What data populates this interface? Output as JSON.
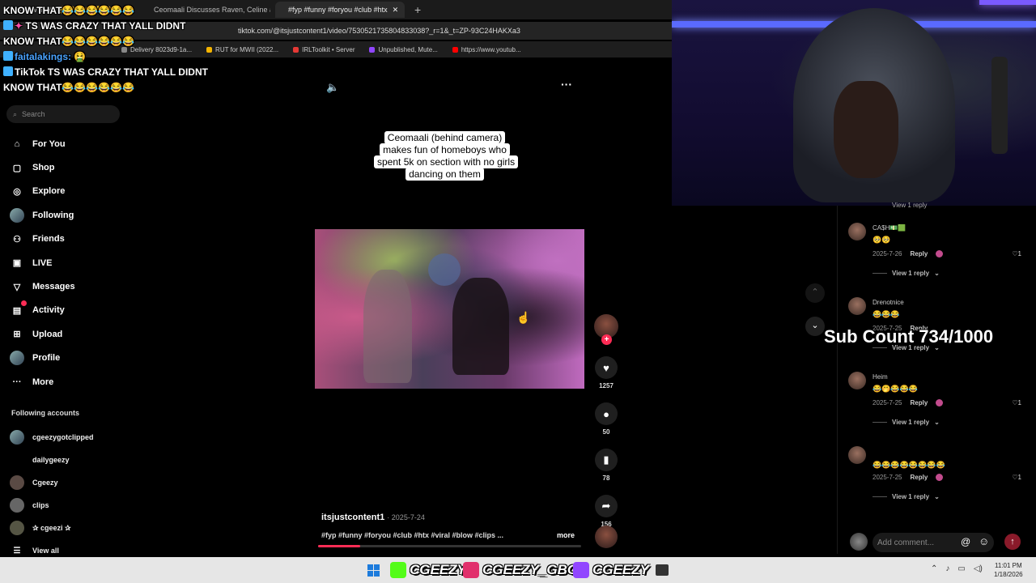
{
  "browser": {
    "tabs": [
      {
        "label": "KNOW THAT😂😂😂😂😂😂",
        "active": false
      },
      {
        "label": "Ceomaali Discusses Raven, Celine an",
        "active": false
      },
      {
        "label": "#fyp #funny #foryou #club #htx",
        "active": true
      }
    ],
    "url": "tiktok.com/@itsjustcontent1/video/7530521735804833038?_r=1&_t=ZP-93C24HAKXa3",
    "bookmarks": [
      "Delivery 8023d9-1a...",
      "RUT for MWII (2022...",
      "IRLToolkit • Server",
      "Unpublished, Mute...",
      "https://www.youtub..."
    ]
  },
  "chat": [
    {
      "name": "",
      "text": "KNOW THAT😂😂😂😂😂😂"
    },
    {
      "name": "",
      "text": "TS WAS CRAZY THAT YALL DIDNT"
    },
    {
      "name": "",
      "text": "KNOW THAT😂😂😂😂😂😂"
    },
    {
      "name": "faitalakings:",
      "text": "🤮"
    },
    {
      "name": "TikTok",
      "text": "TS WAS CRAZY THAT YALL DIDNT"
    },
    {
      "name": "",
      "text": "KNOW THAT😂😂😂😂😂😂"
    }
  ],
  "search": {
    "placeholder": "Search"
  },
  "nav": [
    {
      "label": "For You",
      "icon": "home-icon"
    },
    {
      "label": "Shop",
      "icon": "bag-icon"
    },
    {
      "label": "Explore",
      "icon": "compass-icon"
    },
    {
      "label": "Following",
      "icon": "avatar"
    },
    {
      "label": "Friends",
      "icon": "friends-icon"
    },
    {
      "label": "LIVE",
      "icon": "live-icon"
    },
    {
      "label": "Messages",
      "icon": "send-icon"
    },
    {
      "label": "Activity",
      "icon": "activity-icon"
    },
    {
      "label": "Upload",
      "icon": "plus-square-icon"
    },
    {
      "label": "Profile",
      "icon": "avatar"
    },
    {
      "label": "More",
      "icon": "more-icon"
    }
  ],
  "following_title": "Following accounts",
  "following": [
    "cgeezygotclipped",
    "dailygeezy",
    "Cgeezy",
    "clips",
    "✰ cgeezi ✰",
    "View all"
  ],
  "video": {
    "caption": "Ceomaali (behind camera) makes fun of homeboys who spent 5k on section with no girls dancing on them",
    "author": "itsjustcontent1",
    "date": "2025-7-24",
    "tags": "#fyp #funny #foryou #club #htx #viral #blow #clips ...",
    "more": "more",
    "progress": 0.16
  },
  "actions": {
    "likes": "1257",
    "comments": "50",
    "saves": "78",
    "shares": "156"
  },
  "comments": {
    "top_view_reply": "View 1 reply",
    "items": [
      {
        "name": "CA$H💵🟩",
        "text": "🥺🥺",
        "date": "2025-7-26",
        "reply": "Reply",
        "likes": "1",
        "view_reply": "View 1 reply"
      },
      {
        "name": "Drenotnice",
        "text": "😂😂😂",
        "date": "2025-7-25",
        "reply": "Reply",
        "likes": "",
        "view_reply": "View 1 reply"
      },
      {
        "name": "Heim",
        "text": "😂🤭😂😂😂",
        "date": "2025-7-25",
        "reply": "Reply",
        "likes": "1",
        "view_reply": "View 1 reply"
      },
      {
        "name": "",
        "text": "😂😂😂😂😂😂😂😂",
        "date": "2025-7-25",
        "reply": "Reply",
        "likes": "1",
        "view_reply": "View 1 reply"
      }
    ],
    "input_placeholder": "Add comment..."
  },
  "overlay": {
    "subcount": "Sub Count 734/1000"
  },
  "taskbar": {
    "kick": "CGEEZY",
    "instagram": "CGEEZY_GBC",
    "twitch": "CGEEZY",
    "time": "11:01 PM",
    "date": "1/18/2026"
  },
  "colors": {
    "accent": "#fe2c55",
    "kick": "#53fc18",
    "twitch": "#9146ff",
    "instagram": "#e1306c"
  }
}
